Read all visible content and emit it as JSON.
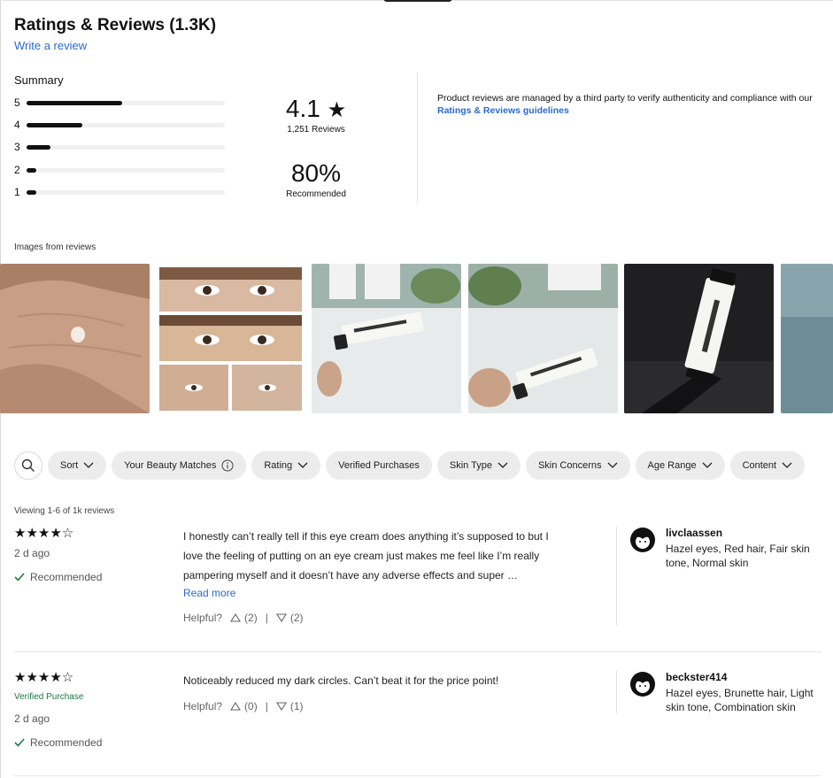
{
  "header": {
    "title": "Ratings & Reviews (1.3K)",
    "write_review": "Write a review"
  },
  "summary": {
    "label": "Summary",
    "distribution": [
      {
        "stars": "5",
        "fraction": 0.48
      },
      {
        "stars": "4",
        "fraction": 0.28
      },
      {
        "stars": "3",
        "fraction": 0.12
      },
      {
        "stars": "2",
        "fraction": 0.05
      },
      {
        "stars": "1",
        "fraction": 0.05
      }
    ],
    "average": "4.1",
    "star_glyph": "★",
    "reviews_count": "1,251 Reviews",
    "recommended_pct": "80%",
    "recommended_label": "Recommended"
  },
  "notice": {
    "text": "Product reviews are managed by a third party to verify authenticity and compliance with our ",
    "link": "Ratings & Reviews guidelines"
  },
  "images": {
    "label": "Images from reviews",
    "thumbs": [
      "hand-swatch",
      "eye-collage",
      "eye-cream-tube-table",
      "eye-cream-tube-hand",
      "eye-cream-tube-dark",
      "partial-blue"
    ]
  },
  "filters": {
    "search_icon": "search-icon",
    "chips": [
      {
        "label": "Sort",
        "chevron": true
      },
      {
        "label": "Your Beauty Matches",
        "info": true
      },
      {
        "label": "Rating",
        "chevron": true
      },
      {
        "label": "Verified Purchases"
      },
      {
        "label": "Skin Type",
        "chevron": true
      },
      {
        "label": "Skin Concerns",
        "chevron": true
      },
      {
        "label": "Age Range",
        "chevron": true
      },
      {
        "label": "Content",
        "chevron": true
      }
    ]
  },
  "reviews_list": {
    "viewing": "Viewing 1-6 of 1k reviews",
    "items": [
      {
        "stars": "★★★★☆",
        "age": "2 d ago",
        "recommended": "Recommended",
        "body": "I honestly can’t really tell if this eye cream does anything it’s supposed to but I love the feeling of putting on an eye cream just makes me feel like I’m really pampering myself and it doesn’t have any adverse effects and super …",
        "read_more": "Read more",
        "helpful_label": "Helpful?",
        "up_count": "(2)",
        "divider": "|",
        "down_count": "(2)",
        "user": "livclaassen",
        "traits": "Hazel eyes, Red hair, Fair skin tone, Normal skin"
      },
      {
        "stars": "★★★★☆",
        "verified": "Verified Purchase",
        "age": "2 d ago",
        "recommended": "Recommended",
        "body": "Noticeably reduced my dark circles. Can’t beat it for the price point!",
        "helpful_label": "Helpful?",
        "up_count": "(0)",
        "divider": "|",
        "down_count": "(1)",
        "user": "beckster414",
        "traits": "Hazel eyes, Brunette hair, Light skin tone, Combination skin"
      }
    ]
  },
  "colors": {
    "link": "#2a6acd",
    "verified": "#1d7a3e",
    "check": "#1d7a3e",
    "chip_bg": "#ececec"
  }
}
